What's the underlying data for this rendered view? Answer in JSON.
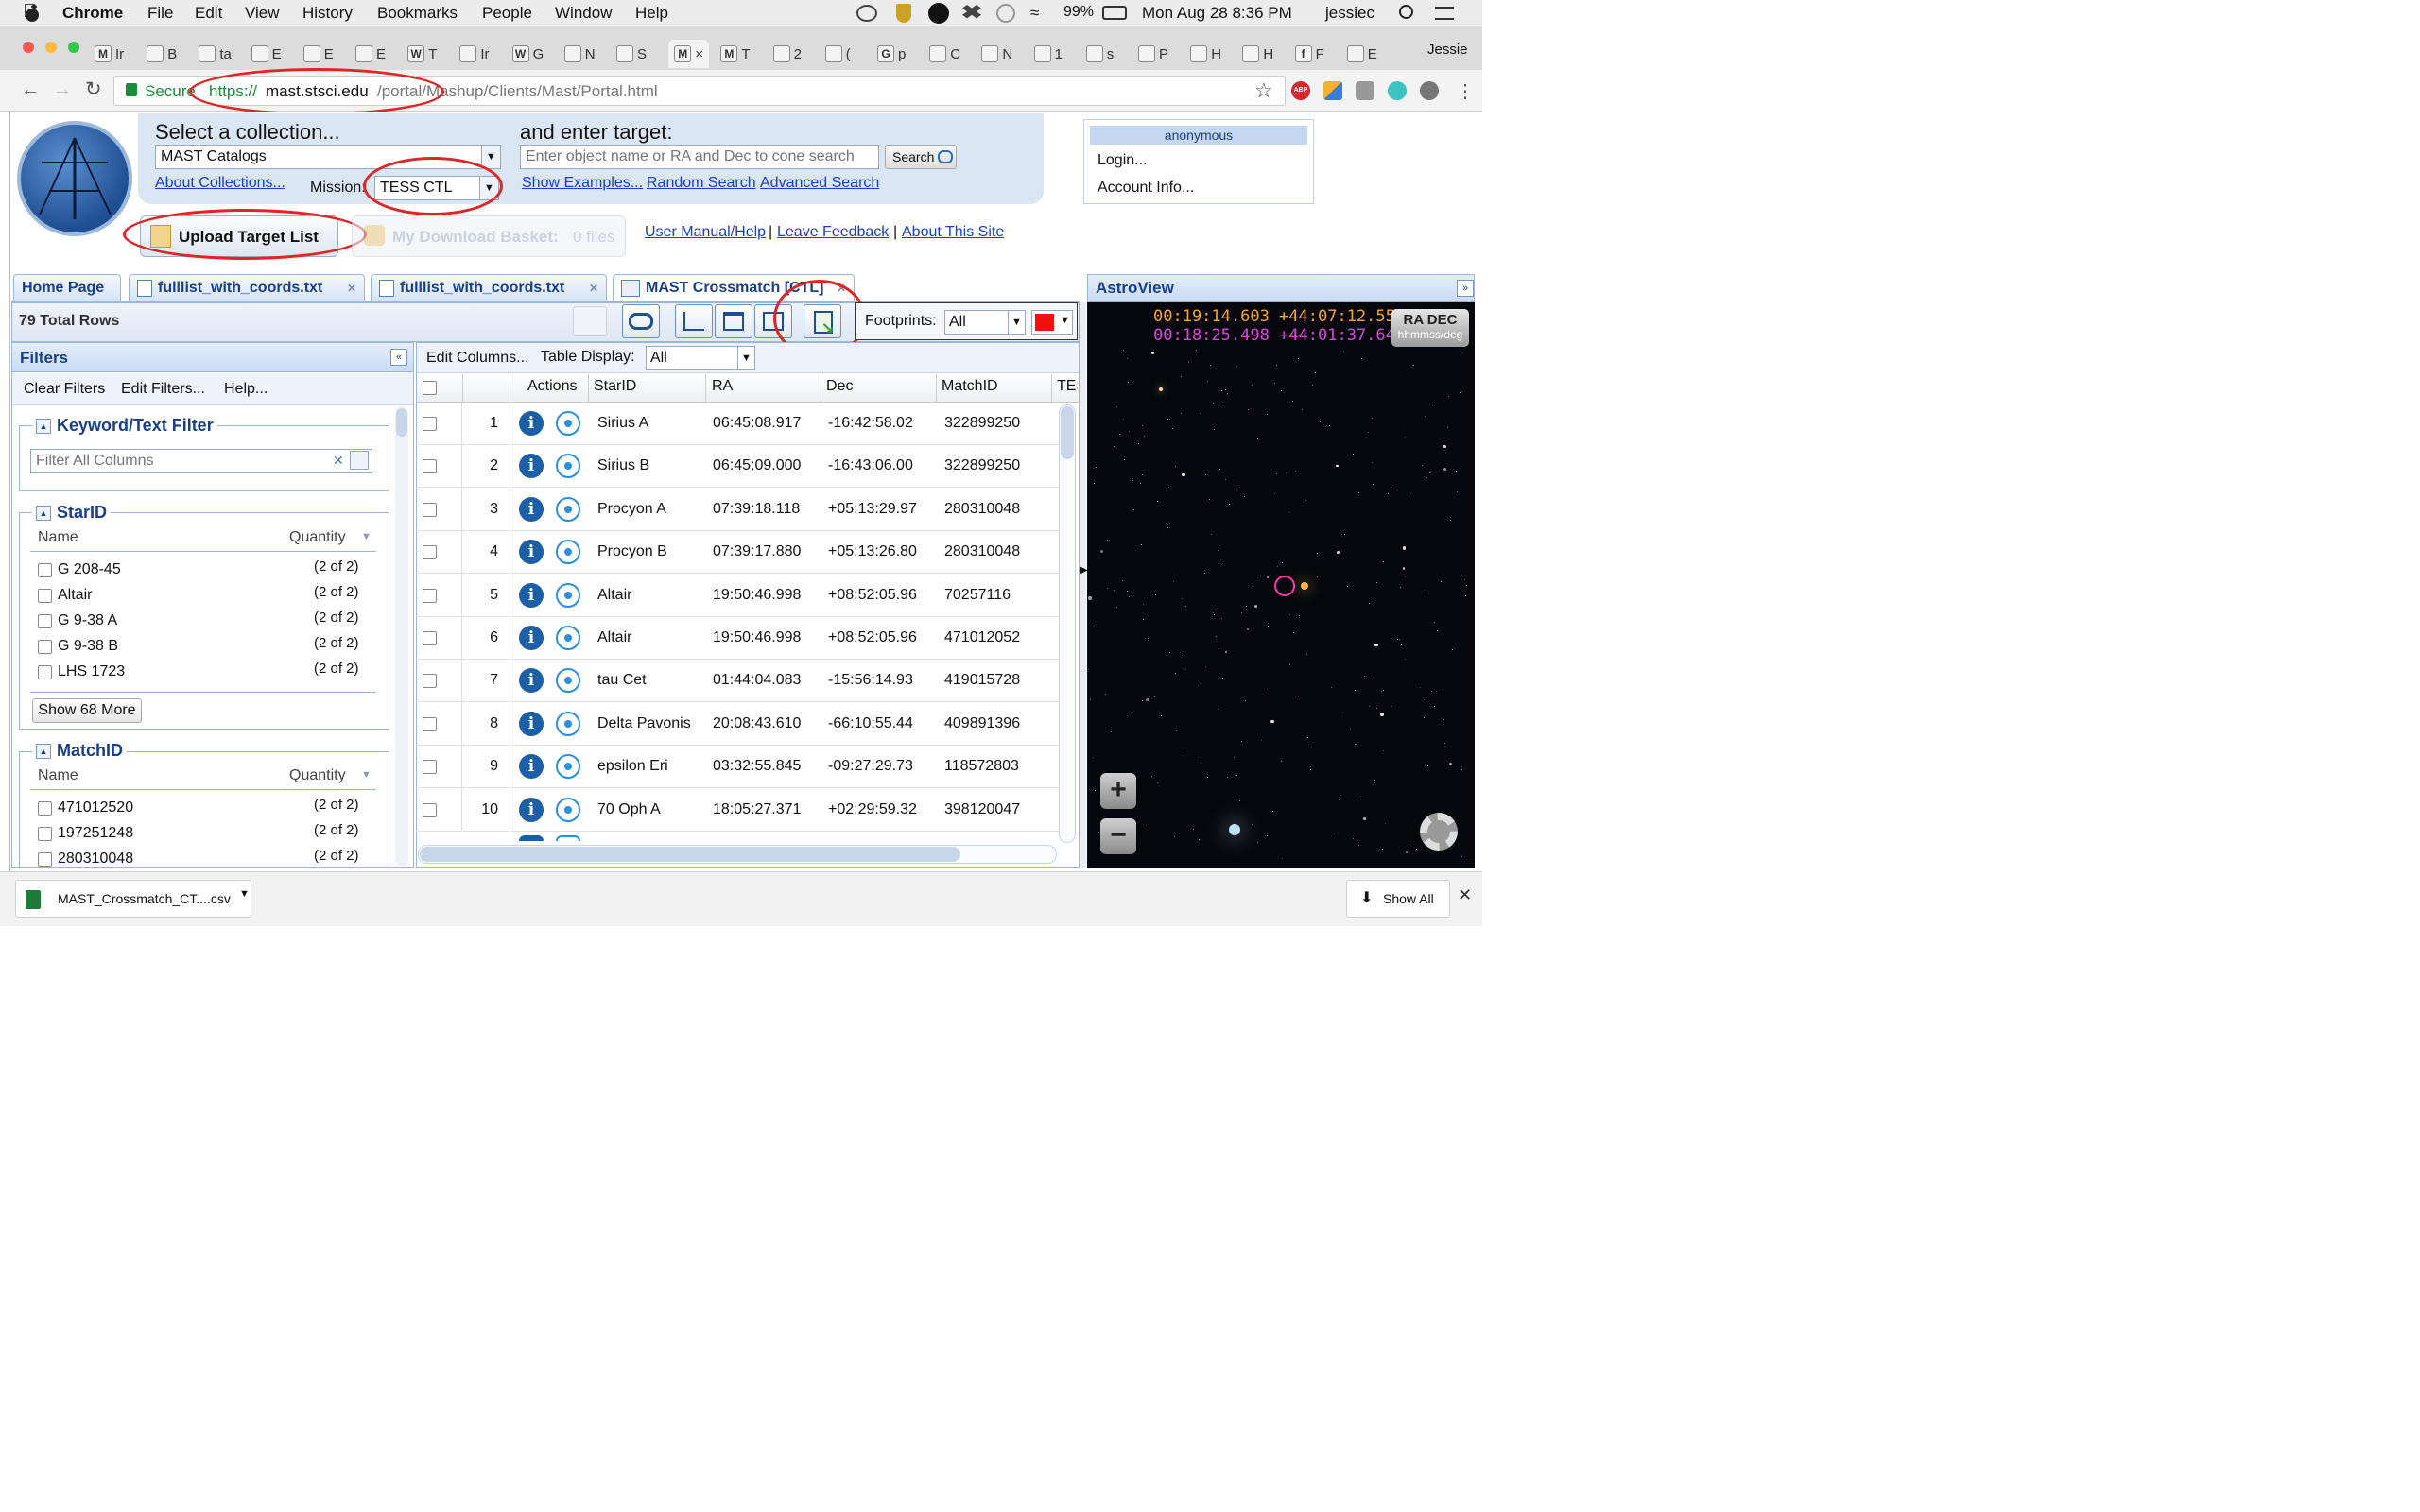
{
  "menubar": {
    "apple": "",
    "app": "Chrome",
    "items": [
      "File",
      "Edit",
      "View",
      "History",
      "Bookmarks",
      "People",
      "Window",
      "Help"
    ],
    "battery": "99%",
    "datetime": "Mon Aug 28  8:36 PM",
    "user": "jessiec"
  },
  "browser": {
    "profile": "Jessie",
    "tabs": [
      {
        "letter": "M",
        "label": "Ir"
      },
      {
        "letter": "",
        "label": "B"
      },
      {
        "letter": "",
        "label": "ta"
      },
      {
        "letter": "",
        "label": "E"
      },
      {
        "letter": "",
        "label": "E"
      },
      {
        "letter": "",
        "label": "E"
      },
      {
        "letter": "W",
        "label": "T"
      },
      {
        "letter": "",
        "label": "Ir"
      },
      {
        "letter": "W",
        "label": "G"
      },
      {
        "letter": "",
        "label": "N"
      },
      {
        "letter": "",
        "label": "S"
      },
      {
        "letter": "M",
        "label": "×"
      },
      {
        "letter": "M",
        "label": "T"
      },
      {
        "letter": "",
        "label": "2"
      },
      {
        "letter": "",
        "label": "("
      },
      {
        "letter": "G",
        "label": "p"
      },
      {
        "letter": "",
        "label": "C"
      },
      {
        "letter": "",
        "label": "N"
      },
      {
        "letter": "",
        "label": "1"
      },
      {
        "letter": "",
        "label": "s"
      },
      {
        "letter": "",
        "label": "P"
      },
      {
        "letter": "",
        "label": "H"
      },
      {
        "letter": "",
        "label": "H"
      },
      {
        "letter": "f",
        "label": "F"
      },
      {
        "letter": "",
        "label": "E"
      }
    ],
    "secure_label": "Secure",
    "url_scheme": "https://",
    "url_host": "mast.stsci.edu",
    "url_path": "/portal/Mashup/Clients/Mast/Portal.html",
    "ext_abp": "ABP"
  },
  "header": {
    "select_collection": "Select a collection...",
    "collection_value": "MAST Catalogs",
    "about_collections": "About Collections...",
    "mission_label": "Mission:",
    "mission_value": "TESS CTL",
    "enter_target": "and enter target:",
    "target_placeholder": "Enter object name or RA and Dec to cone search",
    "search_btn": "Search",
    "show_examples": "Show Examples...",
    "random_search": "Random Search",
    "advanced_search": "Advanced Search",
    "upload_target": "Upload Target List",
    "download_basket": "My Download Basket:",
    "download_count": "0 files",
    "user_manual": "User Manual/Help",
    "sep": "|",
    "leave_feedback": "Leave Feedback",
    "about_site": "About This Site",
    "account_user": "anonymous",
    "login": "Login...",
    "account_info": "Account Info..."
  },
  "tabs": [
    "Home Page",
    "fulllist_with_coords.txt",
    "fulllist_with_coords.txt",
    "MAST Crossmatch [CTL]"
  ],
  "grid": {
    "total_rows": "79 Total Rows",
    "footprints_label": "Footprints:",
    "footprints_value": "All",
    "footprint_color": "#ee1111",
    "edit_columns": "Edit Columns...",
    "table_display_label": "Table Display:",
    "table_display_value": "All",
    "columns": [
      "Actions",
      "StarID",
      "RA",
      "Dec",
      "MatchID",
      "TES"
    ],
    "rows": [
      {
        "n": "1",
        "star": "Sirius A",
        "ra": "06:45:08.917",
        "dec": "-16:42:58.02",
        "match": "322899250"
      },
      {
        "n": "2",
        "star": "Sirius B",
        "ra": "06:45:09.000",
        "dec": "-16:43:06.00",
        "match": "322899250"
      },
      {
        "n": "3",
        "star": "Procyon A",
        "ra": "07:39:18.118",
        "dec": "+05:13:29.97",
        "match": "280310048"
      },
      {
        "n": "4",
        "star": "Procyon B",
        "ra": "07:39:17.880",
        "dec": "+05:13:26.80",
        "match": "280310048"
      },
      {
        "n": "5",
        "star": "Altair",
        "ra": "19:50:46.998",
        "dec": "+08:52:05.96",
        "match": "70257116"
      },
      {
        "n": "6",
        "star": "Altair",
        "ra": "19:50:46.998",
        "dec": "+08:52:05.96",
        "match": "471012052"
      },
      {
        "n": "7",
        "star": "tau Cet",
        "ra": "01:44:04.083",
        "dec": "-15:56:14.93",
        "match": "419015728"
      },
      {
        "n": "8",
        "star": "Delta Pavonis",
        "ra": "20:08:43.610",
        "dec": "-66:10:55.44",
        "match": "409891396"
      },
      {
        "n": "9",
        "star": "epsilon Eri",
        "ra": "03:32:55.845",
        "dec": "-09:27:29.73",
        "match": "118572803"
      },
      {
        "n": "10",
        "star": "70 Oph A",
        "ra": "18:05:27.371",
        "dec": "+02:29:59.32",
        "match": "398120047"
      }
    ]
  },
  "filters": {
    "title": "Filters",
    "clear": "Clear Filters",
    "edit": "Edit Filters...",
    "help": "Help...",
    "keyword_title": "Keyword/Text Filter",
    "keyword_placeholder": "Filter All Columns",
    "name_col": "Name",
    "qty_col": "Quantity",
    "starid_title": "StarID",
    "starid_items": [
      {
        "name": "G 208-45",
        "q": "(2 of 2)"
      },
      {
        "name": "Altair",
        "q": "(2 of 2)"
      },
      {
        "name": "G 9-38 A",
        "q": "(2 of 2)"
      },
      {
        "name": "G 9-38 B",
        "q": "(2 of 2)"
      },
      {
        "name": "LHS 1723",
        "q": "(2 of 2)"
      }
    ],
    "show_more": "Show 68 More",
    "matchid_title": "MatchID",
    "matchid_items": [
      {
        "name": "471012520",
        "q": "(2 of 2)"
      },
      {
        "name": "197251248",
        "q": "(2 of 2)"
      },
      {
        "name": "280310048",
        "q": "(2 of 2)"
      }
    ]
  },
  "astroview": {
    "title": "AstroView",
    "coord1": "00:19:14.603 +44:07:12.55",
    "coord2": "00:18:25.498 +44:01:37.64",
    "radec": "RA DEC",
    "radec_sub": "hhmmss/deg",
    "coord1_color": "#f5a623",
    "coord2_color": "#e040e0"
  },
  "downloads": {
    "file": "MAST_Crossmatch_CT....csv",
    "show_all": "Show All"
  }
}
